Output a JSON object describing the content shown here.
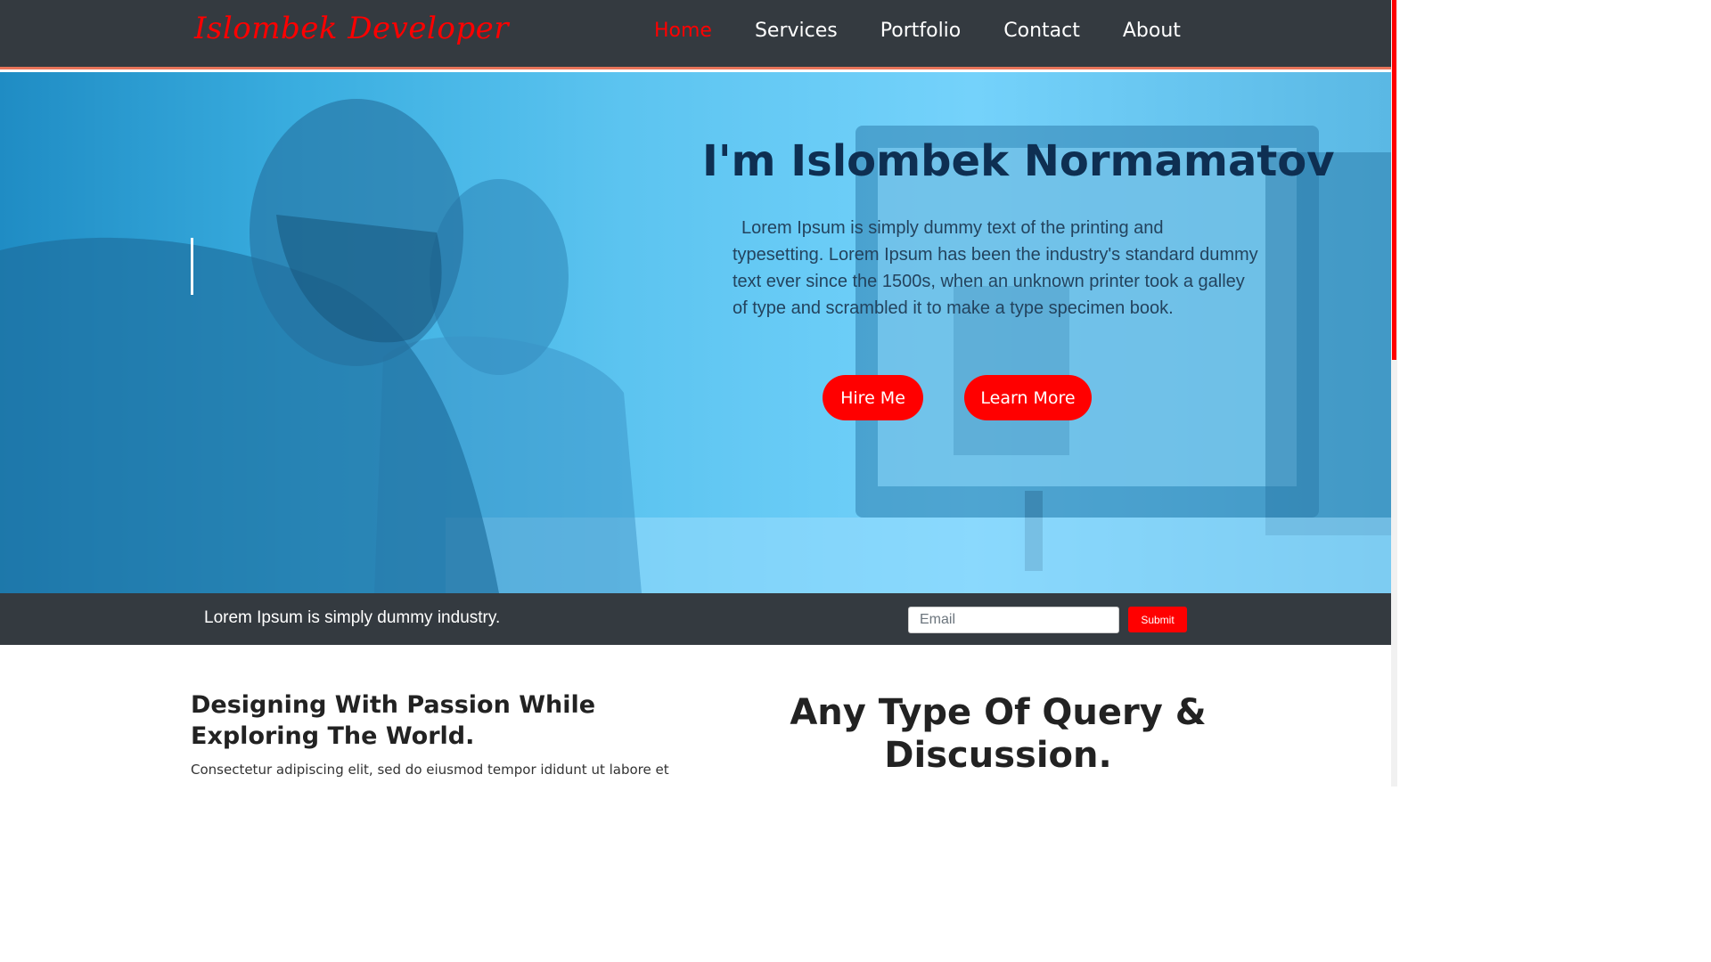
{
  "brand": "Islombek Developer",
  "nav": [
    {
      "label": "Home",
      "active": true
    },
    {
      "label": "Services",
      "active": false
    },
    {
      "label": "Portfolio",
      "active": false
    },
    {
      "label": "Contact",
      "active": false
    },
    {
      "label": "About",
      "active": false
    }
  ],
  "hero": {
    "title": "I'm Islombek Normamatov",
    "text": "Lorem Ipsum is simply dummy text of the printing and typesetting. Lorem Ipsum has been the industry's standard dummy text ever since the 1500s, when an unknown printer took a galley of type and scrambled it to make a type specimen book.",
    "hire_label": "Hire Me",
    "learn_label": "Learn More"
  },
  "strip": {
    "text": "Lorem Ipsum is simply dummy industry.",
    "email_placeholder": "Email",
    "submit_label": "Submit"
  },
  "lower": {
    "left_title": "Designing With Passion While Exploring The World.",
    "left_text": "Consectetur adipiscing elit, sed do eiusmod tempor ididunt ut labore et",
    "right_title": "Any Type Of Query & Discussion."
  },
  "colors": {
    "accent": "#ff0000",
    "nav_bg": "#343a40",
    "nav_border": "#e8745a",
    "hero_overlay": "#5cc4f0",
    "hero_title": "#0e2f52"
  }
}
